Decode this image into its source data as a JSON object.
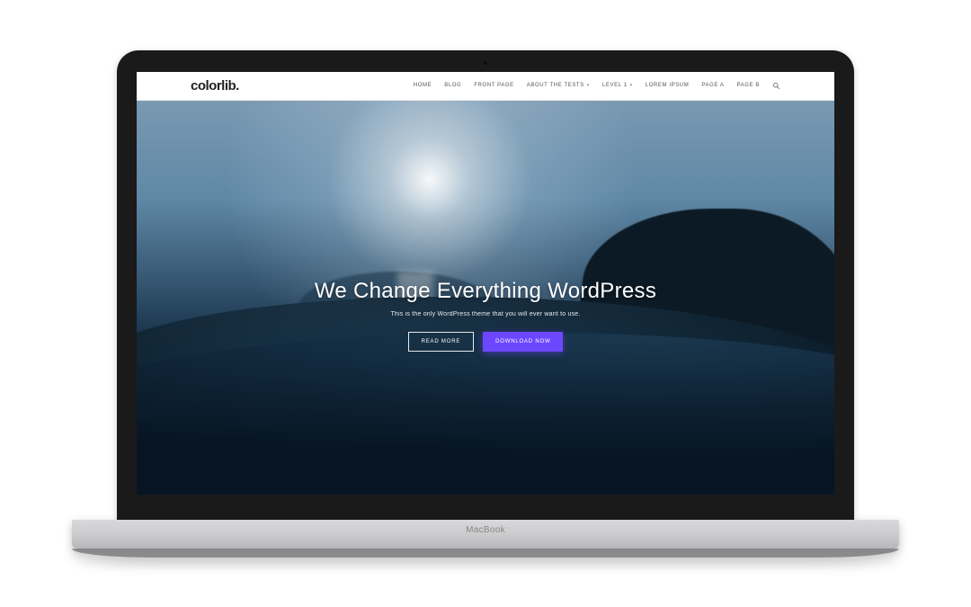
{
  "device": {
    "label": "MacBook"
  },
  "header": {
    "logo": "colorlib",
    "logo_suffix": ".",
    "nav": [
      {
        "label": "HOME",
        "dropdown": false
      },
      {
        "label": "BLOG",
        "dropdown": false
      },
      {
        "label": "FRONT PAGE",
        "dropdown": false
      },
      {
        "label": "ABOUT THE TESTS",
        "dropdown": true
      },
      {
        "label": "LEVEL 1",
        "dropdown": true
      },
      {
        "label": "LOREM IPSUM",
        "dropdown": false
      },
      {
        "label": "PAGE A",
        "dropdown": false
      },
      {
        "label": "PAGE B",
        "dropdown": false
      }
    ],
    "search_icon": "search-icon"
  },
  "hero": {
    "title": "We Change Everything WordPress",
    "subtitle": "This is the only WordPress theme that you will ever want to use.",
    "buttons": {
      "secondary": "READ MORE",
      "primary": "DOWNLOAD NOW"
    }
  },
  "colors": {
    "accent": "#6d47ff",
    "text_dark": "#222222",
    "nav_text": "#555555"
  }
}
